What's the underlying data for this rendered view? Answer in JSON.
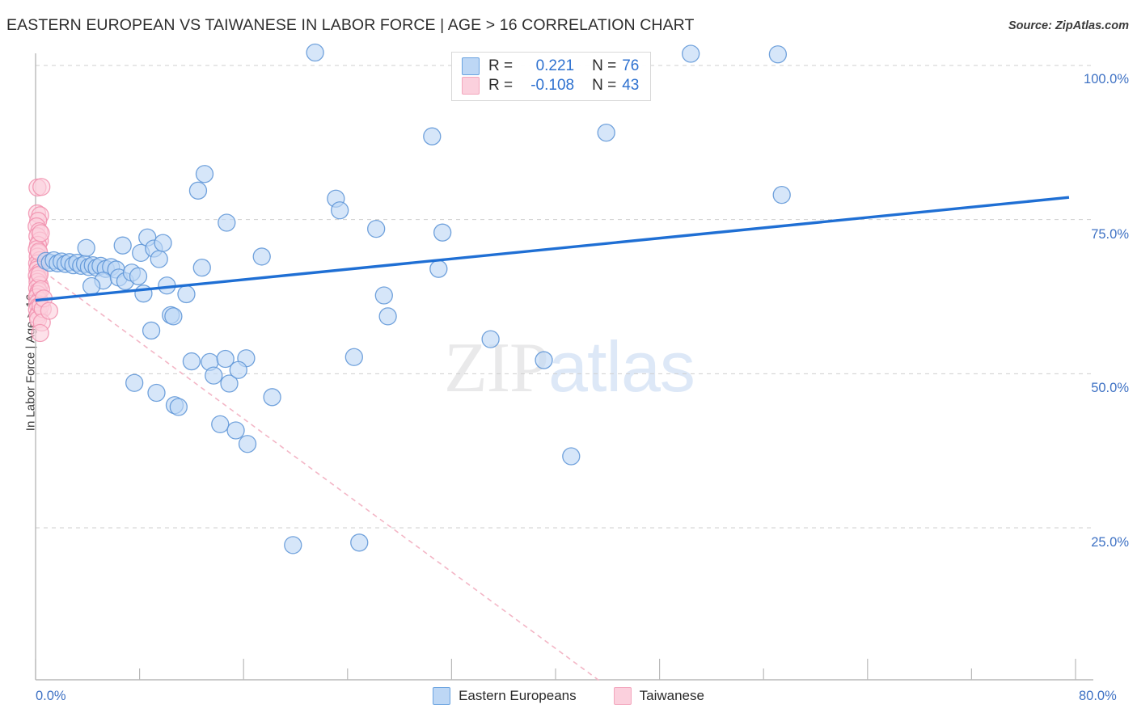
{
  "header": {
    "title": "EASTERN EUROPEAN VS TAIWANESE IN LABOR FORCE | AGE > 16 CORRELATION CHART",
    "source": "Source: ZipAtlas.com"
  },
  "watermark": {
    "part1": "ZIP",
    "part2": "atlas"
  },
  "stats": {
    "rows": [
      {
        "series": "Eastern Europeans",
        "r_label": "R =",
        "r_value": "0.221",
        "n_label": "N =",
        "n_value": "76",
        "color": "#bdd7f5"
      },
      {
        "series": "Taiwanese",
        "r_label": "R =",
        "r_value": "-0.108",
        "n_label": "N =",
        "n_value": "43",
        "color": "#fbd0dd"
      }
    ]
  },
  "legend": {
    "items": [
      {
        "label": "Eastern Europeans",
        "color": "#bdd7f5"
      },
      {
        "label": "Taiwanese",
        "color": "#fbd0dd"
      }
    ]
  },
  "axes": {
    "y_title": "In Labor Force | Age > 16",
    "y_ticks": [
      "100.0%",
      "75.0%",
      "50.0%",
      "25.0%"
    ],
    "x_min_label": "0.0%",
    "x_max_label": "80.0%"
  },
  "chart_data": {
    "type": "scatter",
    "title": "EASTERN EUROPEAN VS TAIWANESE IN LABOR FORCE | AGE > 16 CORRELATION CHART",
    "xlabel": "",
    "ylabel": "In Labor Force | Age > 16",
    "xlim": [
      0,
      80
    ],
    "ylim": [
      0,
      107.5
    ],
    "x_unit": "percent",
    "y_unit": "percent",
    "grid": true,
    "legend_position": "bottom-center",
    "y_gridlines": [
      100.0,
      75.0,
      50.0,
      25.0
    ],
    "series": [
      {
        "name": "Eastern Europeans",
        "color": "#bdd7f5",
        "stroke": "#5b93d6",
        "r": 0.221,
        "n": 76,
        "trendline": {
          "style": "solid",
          "color": "#1f6fd4",
          "x1": 0,
          "y1": 61.9,
          "x2": 79.5,
          "y2": 78.6
        },
        "points": [
          [
            0.8,
            68.3
          ],
          [
            1.1,
            68.0
          ],
          [
            1.4,
            68.4
          ],
          [
            1.7,
            67.9
          ],
          [
            2.0,
            68.2
          ],
          [
            2.3,
            67.8
          ],
          [
            2.6,
            68.1
          ],
          [
            2.9,
            67.6
          ],
          [
            3.2,
            68.0
          ],
          [
            3.5,
            67.5
          ],
          [
            3.8,
            67.8
          ],
          [
            4.1,
            67.3
          ],
          [
            4.4,
            67.6
          ],
          [
            4.7,
            67.2
          ],
          [
            5.0,
            67.5
          ],
          [
            5.4,
            67.0
          ],
          [
            5.8,
            67.3
          ],
          [
            6.2,
            66.9
          ],
          [
            3.9,
            70.4
          ],
          [
            5.2,
            65.1
          ],
          [
            4.3,
            64.2
          ],
          [
            6.4,
            65.6
          ],
          [
            6.9,
            65.0
          ],
          [
            7.4,
            66.4
          ],
          [
            7.9,
            65.8
          ],
          [
            8.3,
            63.0
          ],
          [
            8.1,
            69.6
          ],
          [
            8.6,
            72.1
          ],
          [
            9.1,
            70.3
          ],
          [
            9.5,
            68.6
          ],
          [
            10.1,
            64.3
          ],
          [
            8.9,
            57.0
          ],
          [
            7.6,
            48.5
          ],
          [
            9.3,
            46.9
          ],
          [
            10.7,
            44.9
          ],
          [
            11.0,
            44.6
          ],
          [
            10.4,
            59.5
          ],
          [
            10.6,
            59.3
          ],
          [
            12.0,
            52.0
          ],
          [
            13.4,
            51.9
          ],
          [
            14.6,
            52.4
          ],
          [
            16.2,
            52.5
          ],
          [
            13.7,
            49.7
          ],
          [
            14.9,
            48.4
          ],
          [
            15.6,
            50.6
          ],
          [
            14.2,
            41.8
          ],
          [
            15.4,
            40.8
          ],
          [
            16.3,
            38.6
          ],
          [
            18.2,
            46.2
          ],
          [
            13.0,
            82.4
          ],
          [
            17.4,
            69.0
          ],
          [
            12.5,
            79.7
          ],
          [
            14.7,
            74.5
          ],
          [
            21.5,
            102.1
          ],
          [
            19.8,
            22.2
          ],
          [
            24.9,
            22.6
          ],
          [
            23.1,
            78.4
          ],
          [
            23.4,
            76.5
          ],
          [
            26.2,
            73.5
          ],
          [
            24.5,
            52.7
          ],
          [
            26.8,
            62.7
          ],
          [
            27.1,
            59.3
          ],
          [
            30.5,
            88.5
          ],
          [
            31.3,
            72.9
          ],
          [
            31.0,
            67.0
          ],
          [
            35.0,
            55.6
          ],
          [
            39.1,
            52.2
          ],
          [
            41.2,
            36.6
          ],
          [
            43.9,
            89.1
          ],
          [
            50.4,
            101.9
          ],
          [
            57.1,
            101.8
          ],
          [
            57.4,
            79.0
          ],
          [
            12.8,
            67.2
          ],
          [
            11.6,
            62.9
          ],
          [
            9.8,
            71.2
          ],
          [
            6.7,
            70.8
          ]
        ]
      },
      {
        "name": "Taiwanese",
        "color": "#fbd0dd",
        "stroke": "#f191ae",
        "r": -0.108,
        "n": 43,
        "trendline": {
          "style": "dashed",
          "color": "#f3b6c6",
          "x1": 0.6,
          "y1": 66.6,
          "x2": 43.5,
          "y2": 0.0
        },
        "points": [
          [
            0.15,
            80.2
          ],
          [
            0.45,
            80.3
          ],
          [
            0.12,
            76.0
          ],
          [
            0.35,
            75.7
          ],
          [
            0.2,
            74.8
          ],
          [
            0.08,
            73.9
          ],
          [
            0.28,
            73.1
          ],
          [
            0.14,
            72.3
          ],
          [
            0.33,
            71.6
          ],
          [
            0.18,
            70.9
          ],
          [
            0.1,
            70.2
          ],
          [
            0.26,
            69.6
          ],
          [
            0.16,
            69.0
          ],
          [
            0.3,
            68.4
          ],
          [
            0.12,
            67.9
          ],
          [
            0.22,
            67.4
          ],
          [
            0.14,
            66.9
          ],
          [
            0.28,
            66.4
          ],
          [
            0.1,
            65.9
          ],
          [
            0.2,
            65.4
          ],
          [
            0.15,
            64.9
          ],
          [
            0.32,
            64.4
          ],
          [
            0.12,
            63.9
          ],
          [
            0.24,
            63.4
          ],
          [
            0.17,
            62.9
          ],
          [
            0.09,
            62.4
          ],
          [
            0.29,
            61.9
          ],
          [
            0.13,
            61.4
          ],
          [
            0.21,
            60.9
          ],
          [
            0.11,
            60.4
          ],
          [
            0.26,
            59.9
          ],
          [
            0.16,
            59.4
          ],
          [
            0.19,
            58.8
          ],
          [
            0.31,
            66.1
          ],
          [
            0.42,
            63.7
          ],
          [
            0.38,
            61.0
          ],
          [
            0.55,
            60.5
          ],
          [
            0.48,
            58.3
          ],
          [
            0.62,
            62.2
          ],
          [
            1.05,
            60.2
          ],
          [
            0.35,
            56.6
          ],
          [
            0.25,
            69.8
          ],
          [
            0.4,
            72.8
          ]
        ]
      }
    ]
  }
}
